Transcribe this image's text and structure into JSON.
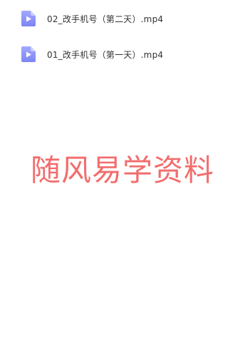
{
  "files": [
    {
      "name": "02_改手机号（第二天）.mp4",
      "icon": "video-file-icon"
    },
    {
      "name": "01_改手机号（第一天）.mp4",
      "icon": "video-file-icon"
    }
  ],
  "watermark": {
    "text": "随风易学资料",
    "color": "#f26d6d"
  },
  "colors": {
    "icon_top": "#9aa1ff",
    "icon_bottom": "#7b83f5",
    "icon_fold": "#c9cdff",
    "text": "#333333"
  }
}
